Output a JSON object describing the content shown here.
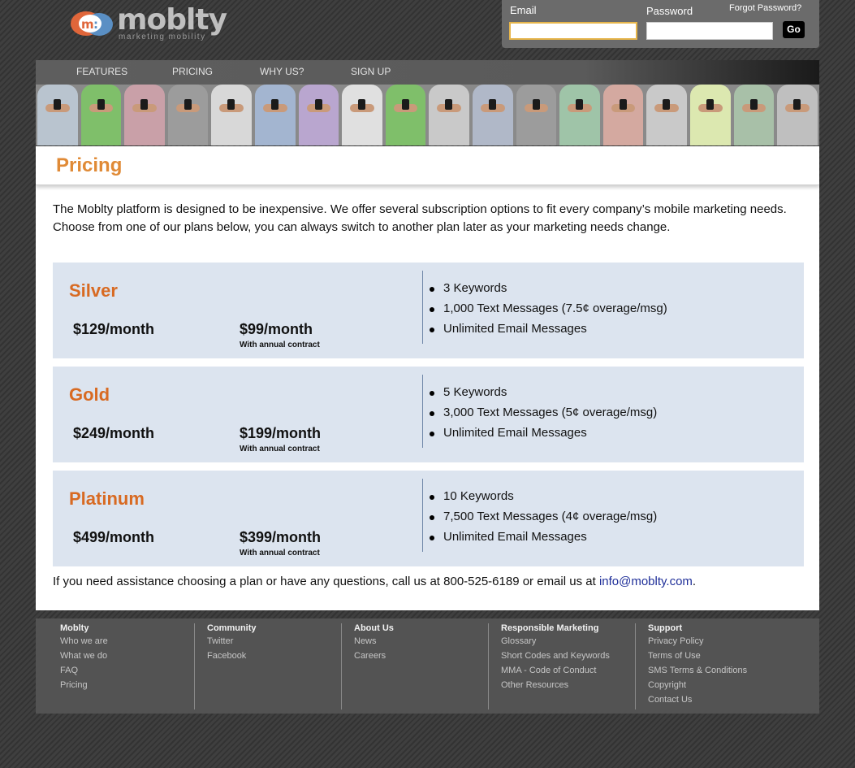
{
  "logo": {
    "word": "moblty",
    "tagline": "marketing mobility"
  },
  "login": {
    "email_label": "Email",
    "password_label": "Password",
    "forgot_label": "Forgot Password?",
    "email_value": "",
    "password_value": "",
    "go_label": "Go"
  },
  "nav": {
    "items": [
      {
        "label": "FEATURES"
      },
      {
        "label": "PRICING"
      },
      {
        "label": "WHY US?"
      },
      {
        "label": "SIGN UP"
      }
    ]
  },
  "page": {
    "title": "Pricing",
    "intro": "The Moblty platform is designed to be inexpensive. We offer several subscription options to fit every company’s mobile marketing needs. Choose from one of our plans below, you can always switch to another plan later as your marketing needs change."
  },
  "plans": [
    {
      "name": "Silver",
      "monthly": "$129/month",
      "annual": "$99/month",
      "annual_note": "With annual contract",
      "features": [
        "3 Keywords",
        "1,000 Text Messages (7.5¢ overage/msg)",
        "Unlimited Email Messages"
      ]
    },
    {
      "name": "Gold",
      "monthly": "$249/month",
      "annual": "$199/month",
      "annual_note": "With annual contract",
      "features": [
        "5 Keywords",
        "3,000 Text Messages (5¢ overage/msg)",
        "Unlimited Email Messages"
      ]
    },
    {
      "name": "Platinum",
      "monthly": "$499/month",
      "annual": "$399/month",
      "annual_note": "With annual contract",
      "features": [
        "10 Keywords",
        "7,500 Text Messages (4¢ overage/msg)",
        "Unlimited Email Messages"
      ]
    }
  ],
  "contact": {
    "text": "If you need assistance choosing a plan or have any questions, call us at 800-525-6189 or email us at",
    "email": "info@moblty.com",
    "end": "."
  },
  "footer": {
    "columns": [
      {
        "heading": "Moblty",
        "links": [
          "Who we are",
          "What we do",
          "FAQ",
          "Pricing"
        ]
      },
      {
        "heading": "Community",
        "links": [
          "Twitter",
          "Facebook"
        ]
      },
      {
        "heading": "About Us",
        "links": [
          "News",
          "Careers"
        ]
      },
      {
        "heading": "Responsible Marketing",
        "links": [
          "Glossary",
          "Short Codes and Keywords",
          "MMA - Code of Conduct",
          "Other Resources"
        ]
      },
      {
        "heading": "Support",
        "links": [
          "Privacy Policy",
          "Terms of Use",
          "SMS Terms & Conditions",
          "Copyright",
          "Contact Us"
        ]
      }
    ]
  },
  "colors": {
    "accent_orange": "#e08a36",
    "plan_name": "#d86a22",
    "plan_bg": "#dce4ef",
    "link_blue": "#1f2f99"
  },
  "banner": {
    "shirt_colors": [
      "#b9c4cf",
      "#7fbf6a",
      "#c9a0a8",
      "#9c9c9c",
      "#d8d8d8",
      "#a3b5d0",
      "#b9a6cf",
      "#e0e0e0",
      "#7fbf6a",
      "#c9c9c9",
      "#b0b8c8",
      "#9c9c9c",
      "#9fc4a8",
      "#d4a9a0",
      "#c9c9c9",
      "#dce8b0",
      "#a8c0a8",
      "#bfbfbf"
    ]
  }
}
